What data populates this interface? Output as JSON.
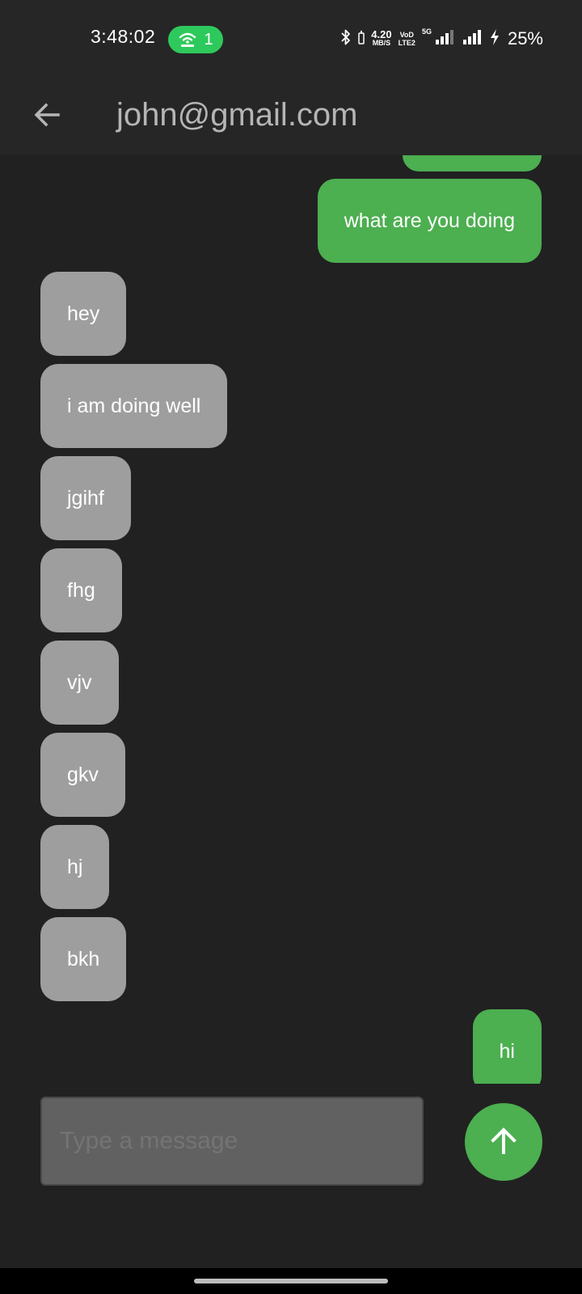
{
  "status_bar": {
    "time": "3:48:02",
    "hotspot_count": "1",
    "net_speed_value": "4.20",
    "net_speed_unit": "MB/S",
    "volte_top": "VoD",
    "volte_bottom": "LTE2",
    "network_type": "5G",
    "battery_percent": "25%",
    "icons": [
      "hotspot-icon",
      "bluetooth-icon",
      "signal-icon",
      "charging-icon"
    ]
  },
  "app_bar": {
    "back_icon": "arrow-left-icon",
    "title": "john@gmail.com"
  },
  "messages": [
    {
      "sender": "me",
      "text": "what are you doing"
    },
    {
      "sender": "other",
      "text": "hey"
    },
    {
      "sender": "other",
      "text": "i am doing well"
    },
    {
      "sender": "other",
      "text": "jgihf"
    },
    {
      "sender": "other",
      "text": "fhg"
    },
    {
      "sender": "other",
      "text": "vjv"
    },
    {
      "sender": "other",
      "text": "gkv"
    },
    {
      "sender": "other",
      "text": "hj"
    },
    {
      "sender": "other",
      "text": "bkh"
    },
    {
      "sender": "me",
      "text": "hi"
    }
  ],
  "composer": {
    "placeholder": "Type a message",
    "value": "",
    "send_icon": "arrow-up-icon"
  },
  "colors": {
    "background": "#212121",
    "app_bar": "#262626",
    "sent_bubble": "#4caf50",
    "received_bubble": "#9e9e9e",
    "input_background": "#616161",
    "hotspot_pill": "#2ec95c"
  }
}
